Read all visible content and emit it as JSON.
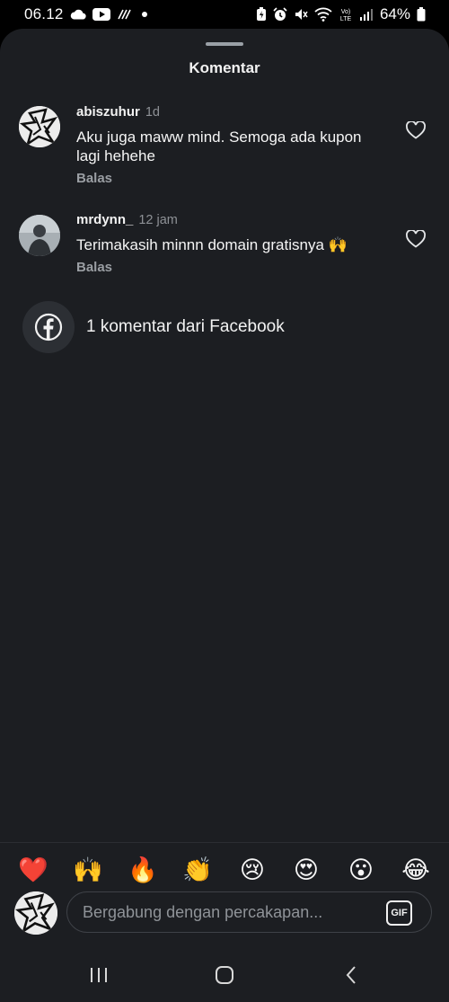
{
  "status_bar": {
    "time": "06.12",
    "battery": "64%",
    "network_label": "LTE",
    "volte_label": "VoLTE"
  },
  "sheet": {
    "title": "Komentar"
  },
  "comments": [
    {
      "username": "abiszuhur",
      "time": "1d",
      "text": "Aku juga maww mind. Semoga ada kupon lagi hehehe",
      "reply_label": "Balas"
    },
    {
      "username": "mrdynn_",
      "time": "12 jam",
      "text": "Terimakasih minnn domain gratisnya 🙌",
      "reply_label": "Balas"
    }
  ],
  "facebook": {
    "label": "1 komentar dari Facebook"
  },
  "emoji_bar": [
    "❤️",
    "🙌",
    "🔥",
    "👏",
    "😢",
    "😍",
    "😮",
    "😂"
  ],
  "composer": {
    "placeholder": "Bergabung dengan percakapan...",
    "gif_label": "GIF"
  },
  "colors": {
    "sheet_bg": "#1c1e22",
    "text": "#f5f5f5",
    "muted": "#8e9196",
    "heart_red": "#ff3040"
  }
}
